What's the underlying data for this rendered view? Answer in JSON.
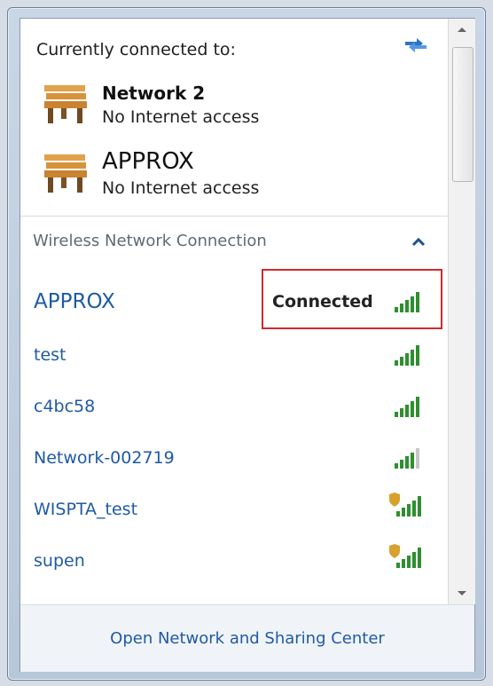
{
  "header": {
    "title": "Currently connected to:",
    "refresh_icon": "refresh-arrows-icon"
  },
  "current_connections": [
    {
      "name": "Network  2",
      "status": "No Internet access"
    },
    {
      "name": "APPROX",
      "status": "No Internet access"
    }
  ],
  "section": {
    "title": "Wireless Network Connection",
    "collapse_icon": "chevron-up-icon"
  },
  "networks": [
    {
      "name": "APPROX",
      "status": "Connected",
      "secured": false,
      "signal_bars": 5
    },
    {
      "name": "test",
      "secured": false,
      "signal_bars": 5
    },
    {
      "name": "c4bc58",
      "secured": false,
      "signal_bars": 5
    },
    {
      "name": "Network-002719",
      "secured": false,
      "signal_bars": 4
    },
    {
      "name": "WISPTA_test",
      "secured": true,
      "signal_bars": 5
    },
    {
      "name": "supen",
      "secured": true,
      "signal_bars": 5
    }
  ],
  "footer": {
    "link_label": "Open Network and Sharing Center"
  },
  "colors": {
    "link": "#1f5aa6",
    "highlight_border": "#d12a2a",
    "signal_green": "#2f8f2f",
    "signal_inactive": "#c7c7c7",
    "shield": "#d8a12e"
  }
}
